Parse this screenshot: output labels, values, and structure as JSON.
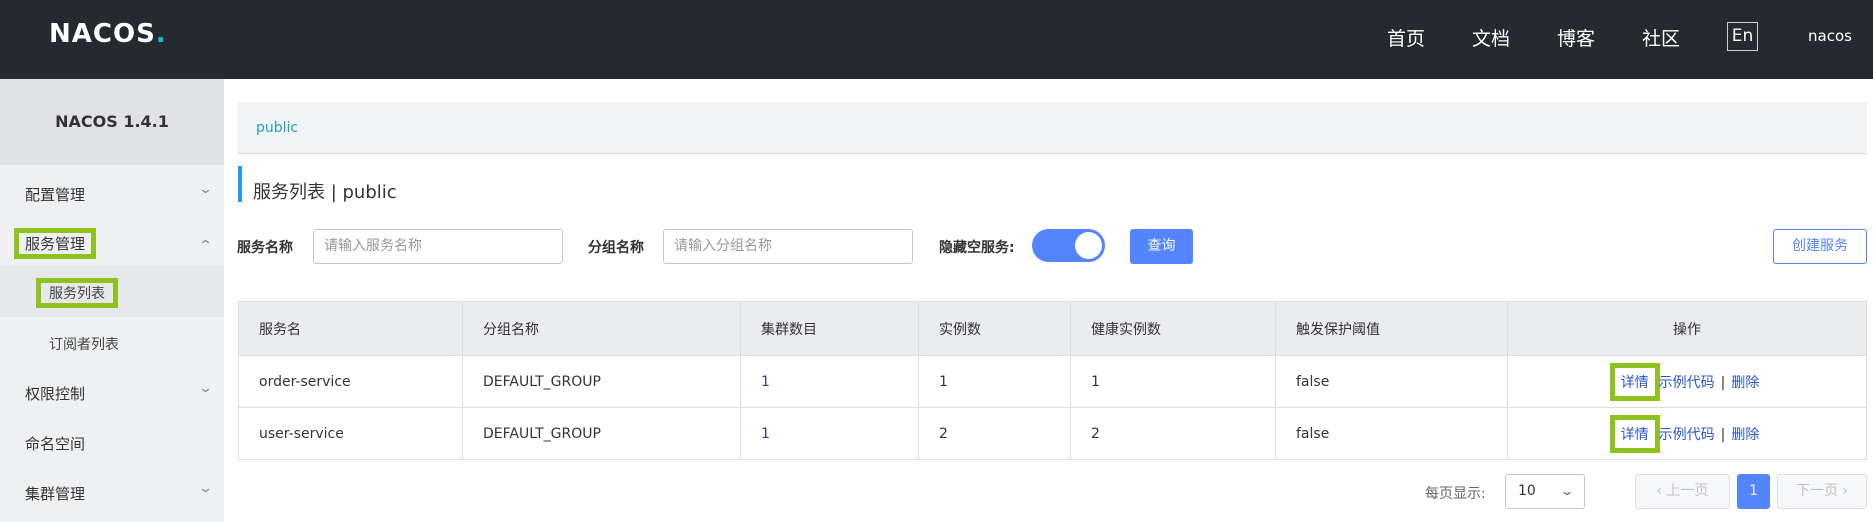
{
  "header": {
    "logo_text": "NACOS",
    "logo_dot": ".",
    "nav": [
      "首页",
      "文档",
      "博客",
      "社区"
    ],
    "lang": "En",
    "user": "nacos"
  },
  "sidebar": {
    "version": "NACOS 1.4.1",
    "items": [
      {
        "label": "配置管理"
      },
      {
        "label": "服务管理"
      },
      {
        "label": "服务列表"
      },
      {
        "label": "订阅者列表"
      },
      {
        "label": "权限控制"
      },
      {
        "label": "命名空间"
      },
      {
        "label": "集群管理"
      }
    ]
  },
  "breadcrumb": "public",
  "page_title": "服务列表  |  public",
  "filters": {
    "service_name_label": "服务名称",
    "service_name_placeholder": "请输入服务名称",
    "group_name_label": "分组名称",
    "group_name_placeholder": "请输入分组名称",
    "hide_empty_label": "隐藏空服务:",
    "hide_empty_on": true,
    "query_label": "查询",
    "create_label": "创建服务"
  },
  "table": {
    "columns": [
      "服务名",
      "分组名称",
      "集群数目",
      "实例数",
      "健康实例数",
      "触发保护阈值",
      "操作"
    ],
    "rows": [
      [
        "order-service",
        "DEFAULT_GROUP",
        "1",
        "1",
        "1",
        "false"
      ],
      [
        "user-service",
        "DEFAULT_GROUP",
        "1",
        "2",
        "2",
        "false"
      ]
    ],
    "actions": {
      "detail": "详情",
      "sample": "示例代码",
      "sep": "|",
      "delete": "删除"
    }
  },
  "pagination": {
    "per_page_label": "每页显示:",
    "per_page_value": "10",
    "prev": "上一页",
    "current": "1",
    "next": "下一页"
  },
  "colors": {
    "primary": "#5584ff",
    "highlight": "#8dc21f",
    "topbar": "#252a2f"
  }
}
